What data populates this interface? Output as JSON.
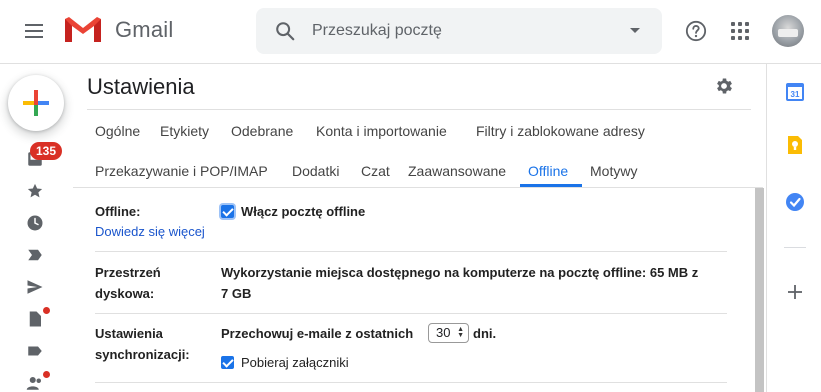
{
  "app": {
    "name": "Gmail"
  },
  "search": {
    "placeholder": "Przeszukaj pocztę"
  },
  "header": {
    "icons": [
      "menu-icon",
      "gmail-logo",
      "search-icon",
      "dropdown-caret-icon",
      "help-icon",
      "apps-icon",
      "avatar"
    ]
  },
  "rail": {
    "badge": "135",
    "icons": [
      "compose-plus-icon",
      "inbox-icon",
      "star-icon",
      "clock-icon",
      "label-important-icon",
      "send-icon",
      "draft-icon",
      "label-icon",
      "contacts-icon"
    ]
  },
  "settings": {
    "title": "Ustawienia",
    "tabs_row1": [
      "Ogólne",
      "Etykiety",
      "Odebrane",
      "Konta i importowanie",
      "Filtry i zablokowane adresy"
    ],
    "tabs_row2": [
      "Przekazywanie i POP/IMAP",
      "Dodatki",
      "Czat",
      "Zaawansowane",
      "Offline",
      "Motywy"
    ],
    "active_tab": "Offline",
    "offline": {
      "label": "Offline:",
      "learn_more": "Dowiedz się więcej",
      "enable_label": "Włącz pocztę offline",
      "enabled": true
    },
    "storage": {
      "label_line1": "Przestrzeń",
      "label_line2": "dyskowa:",
      "value_line1": "Wykorzystanie miejsca dostępnego na komputerze na pocztę offline: 65 MB z",
      "value_line2": "7 GB"
    },
    "sync": {
      "label_line1": "Ustawienia",
      "label_line2": "synchronizacji:",
      "keep_prefix": "Przechowuj e-maile z ostatnich",
      "days_value": "30",
      "keep_suffix": "dni.",
      "attachments_label": "Pobieraj załączniki",
      "attachments_enabled": true
    }
  },
  "side_panel": {
    "calendar_day": "31",
    "icons": [
      "calendar-icon",
      "keep-icon",
      "tasks-icon",
      "add-icon"
    ]
  },
  "colors": {
    "accent": "#1a73e8",
    "badge": "#d93025",
    "link": "#1a55cc"
  }
}
